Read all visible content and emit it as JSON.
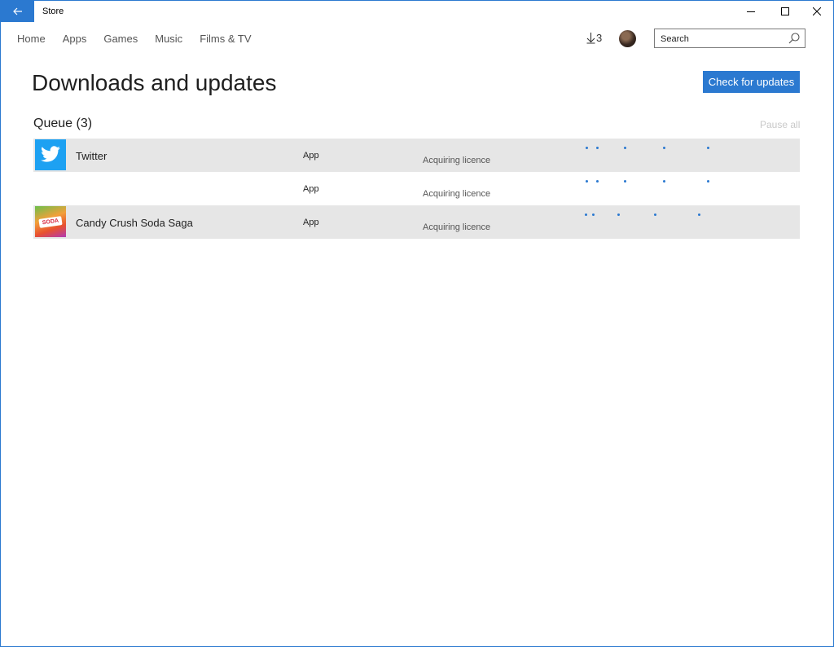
{
  "titlebar": {
    "app_title": "Store",
    "back_icon": "arrow-left-icon",
    "controls": [
      "minimize-icon",
      "maximize-icon",
      "close-icon"
    ]
  },
  "nav": {
    "items": [
      {
        "label": "Home"
      },
      {
        "label": "Apps"
      },
      {
        "label": "Games"
      },
      {
        "label": "Music"
      },
      {
        "label": "Films & TV"
      }
    ]
  },
  "header": {
    "downloads_count": "3",
    "search_placeholder": "Search"
  },
  "page": {
    "title": "Downloads and updates",
    "check_button": "Check for updates",
    "queue_title": "Queue (3)",
    "pause_all": "Pause all"
  },
  "queue": [
    {
      "name": "Twitter",
      "type": "App",
      "status": "Acquiring licence",
      "icon": "twitter-icon"
    },
    {
      "name": "",
      "type": "App",
      "status": "Acquiring licence",
      "icon": ""
    },
    {
      "name": "Candy Crush Soda Saga",
      "type": "App",
      "status": "Acquiring licence",
      "icon": "candy-crush-icon",
      "icon_text": "SODA"
    }
  ],
  "colors": {
    "accent": "#2b79d0",
    "row_shade": "#e6e6e6",
    "disabled_text": "#c8c8c8"
  }
}
